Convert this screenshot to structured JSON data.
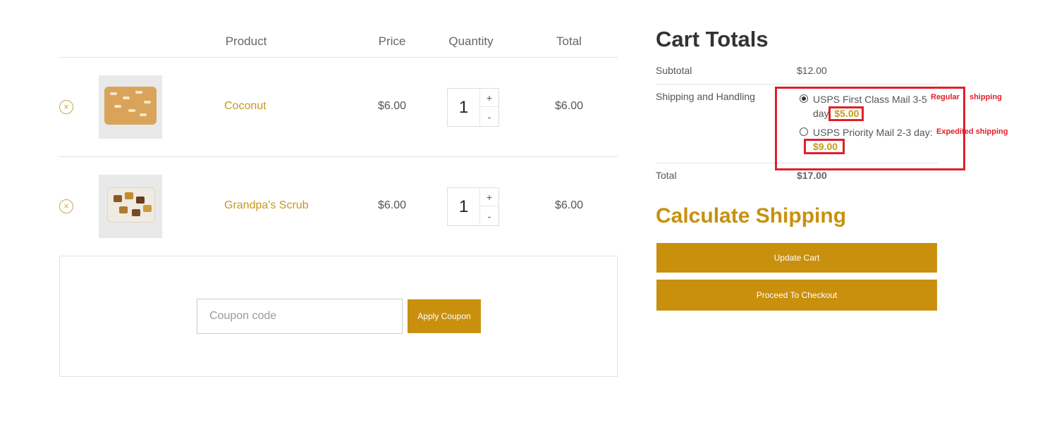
{
  "cart": {
    "headers": {
      "product": "Product",
      "price": "Price",
      "quantity": "Quantity",
      "total": "Total"
    },
    "items": [
      {
        "name": "Coconut",
        "price": "$6.00",
        "quantity": "1",
        "total": "$6.00",
        "remove_icon": "remove-circle-icon"
      },
      {
        "name": "Grandpa's Scrub",
        "price": "$6.00",
        "quantity": "1",
        "total": "$6.00",
        "remove_icon": "remove-circle-icon"
      }
    ],
    "qty_plus": "+",
    "qty_minus": "-",
    "remove_symbol": "×"
  },
  "coupon": {
    "placeholder": "Coupon code",
    "apply_label": "Apply Coupon"
  },
  "totals": {
    "title": "Cart Totals",
    "subtotal_label": "Subtotal",
    "subtotal_value": "$12.00",
    "shipping_label": "Shipping and Handling",
    "shipping_options": [
      {
        "label": "USPS First Class Mail 3-5 day:",
        "price": "$5.00",
        "selected": true
      },
      {
        "label": "USPS Priority Mail 2-3 day:",
        "price": "$9.00",
        "selected": false
      }
    ],
    "total_label": "Total",
    "total_value": "$17.00"
  },
  "annotations": {
    "regular_word": "Regular",
    "shipping_word": "shipping",
    "expedited": "Expedited shipping"
  },
  "shipping_calc": {
    "title": "Calculate Shipping",
    "update_label": "Update Cart",
    "checkout_label": "Proceed To Checkout"
  },
  "colors": {
    "accent": "#c9900e",
    "link": "#c49a1d",
    "annotation": "#e0202a"
  }
}
